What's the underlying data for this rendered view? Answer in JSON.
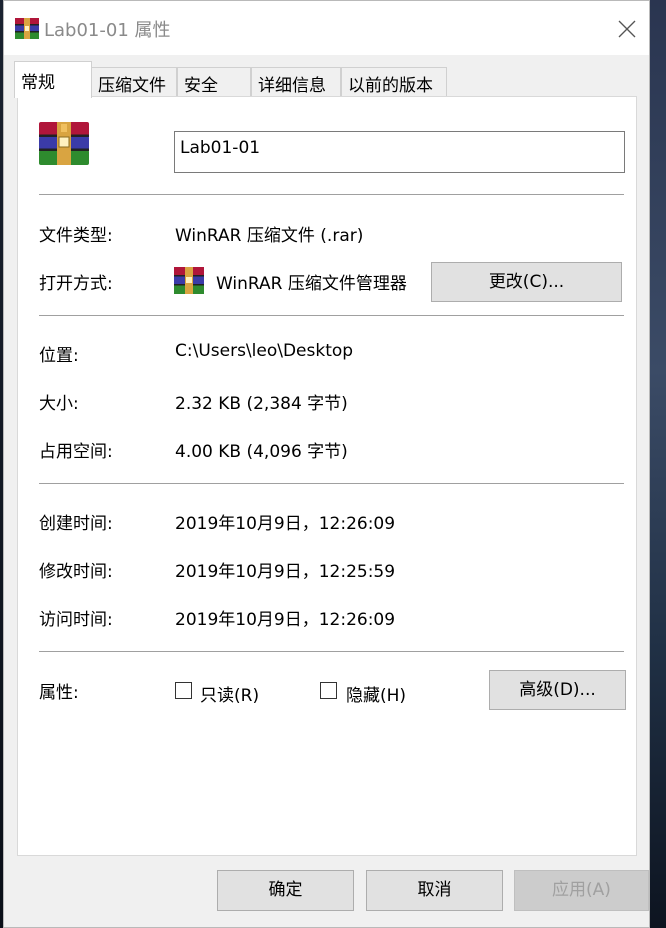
{
  "window": {
    "title": "Lab01-01 属性"
  },
  "tabs": [
    {
      "label": "常规"
    },
    {
      "label": "压缩文件"
    },
    {
      "label": "安全"
    },
    {
      "label": "详细信息"
    },
    {
      "label": "以前的版本"
    }
  ],
  "general": {
    "file_name": "Lab01-01",
    "type_label": "文件类型:",
    "type_value": "WinRAR 压缩文件 (.rar)",
    "opens_label": "打开方式:",
    "opens_value": "WinRAR 压缩文件管理器",
    "change_button": "更改(C)...",
    "location_label": "位置:",
    "location_value": "C:\\Users\\leo\\Desktop",
    "size_label": "大小:",
    "size_value": "2.32 KB (2,384 字节)",
    "disk_size_label": "占用空间:",
    "disk_size_value": "4.00 KB (4,096 字节)",
    "created_label": "创建时间:",
    "created_value": "2019年10月9日，12:26:09",
    "modified_label": "修改时间:",
    "modified_value": "2019年10月9日，12:25:59",
    "accessed_label": "访问时间:",
    "accessed_value": "2019年10月9日，12:26:09",
    "attributes_label": "属性:",
    "readonly_label": "只读(R)",
    "readonly_checked": false,
    "hidden_label": "隐藏(H)",
    "hidden_checked": false,
    "advanced_button": "高级(D)..."
  },
  "footer": {
    "ok": "确定",
    "cancel": "取消",
    "apply": "应用(A)"
  },
  "icons": {
    "title": "winrar-icon",
    "file": "winrar-archive-icon",
    "opener": "winrar-app-icon",
    "close": "close-icon"
  }
}
